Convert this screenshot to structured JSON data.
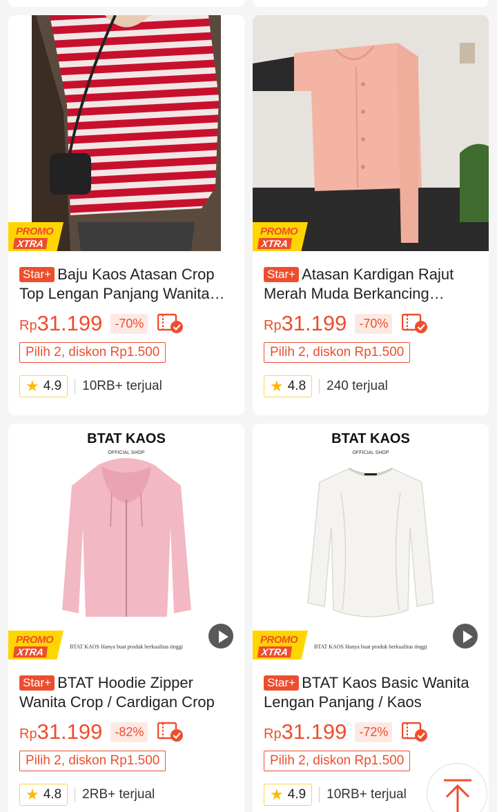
{
  "products": [
    {
      "badge": "Star+",
      "title": "Baju Kaos Atasan Crop Top Lengan Panjang Wanita Bergaris",
      "currency": "Rp",
      "price": "31.199",
      "discount": "-70%",
      "combo": "Pilih 2, diskon Rp1.500",
      "rating": "4.9",
      "sold": "10RB+ terjual",
      "promo_line1": "PROMO",
      "promo_line2": "XTRA",
      "has_video": false,
      "image_icon": "striped-shirt-image"
    },
    {
      "badge": "Star+",
      "title": "Atasan Kardigan Rajut Merah Muda Berkancing Tunggal",
      "currency": "Rp",
      "price": "31.199",
      "discount": "-70%",
      "combo": "Pilih 2, diskon Rp1.500",
      "rating": "4.8",
      "sold": "240 terjual",
      "promo_line1": "PROMO",
      "promo_line2": "XTRA",
      "has_video": false,
      "image_icon": "pink-cardigan-image"
    },
    {
      "badge": "Star+",
      "title": "BTAT Hoodie Zipper Wanita Crop / Cardigan Crop",
      "currency": "Rp",
      "price": "31.199",
      "discount": "-82%",
      "combo": "Pilih 2, diskon Rp1.500",
      "rating": "4.8",
      "sold": "2RB+ terjual",
      "promo_line1": "PROMO",
      "promo_line2": "XTRA",
      "has_video": true,
      "image_icon": "pink-hoodie-image",
      "brand_text": "BTAT KAOS",
      "brand_sub": "OFFICIAL SHOP",
      "brand_footer": "BTAT KAOS Hanya buat produk berkualitas tinggi"
    },
    {
      "badge": "Star+",
      "title": "BTAT Kaos Basic Wanita Lengan Panjang / Kaos",
      "currency": "Rp",
      "price": "31.199",
      "discount": "-72%",
      "combo": "Pilih 2, diskon Rp1.500",
      "rating": "4.9",
      "sold": "10RB+ terjual",
      "promo_line1": "PROMO",
      "promo_line2": "XTRA",
      "has_video": true,
      "image_icon": "white-tee-image",
      "brand_text": "BTAT KAOS",
      "brand_sub": "OFFICIAL SHOP",
      "brand_footer": "BTAT KAOS Hanya buat produk berkualitas tinggi"
    }
  ],
  "colors": {
    "accent": "#ee4d2d",
    "promo_yellow": "#ffd500",
    "star": "#ffb800"
  },
  "back_to_top_icon": "arrow-up-icon"
}
